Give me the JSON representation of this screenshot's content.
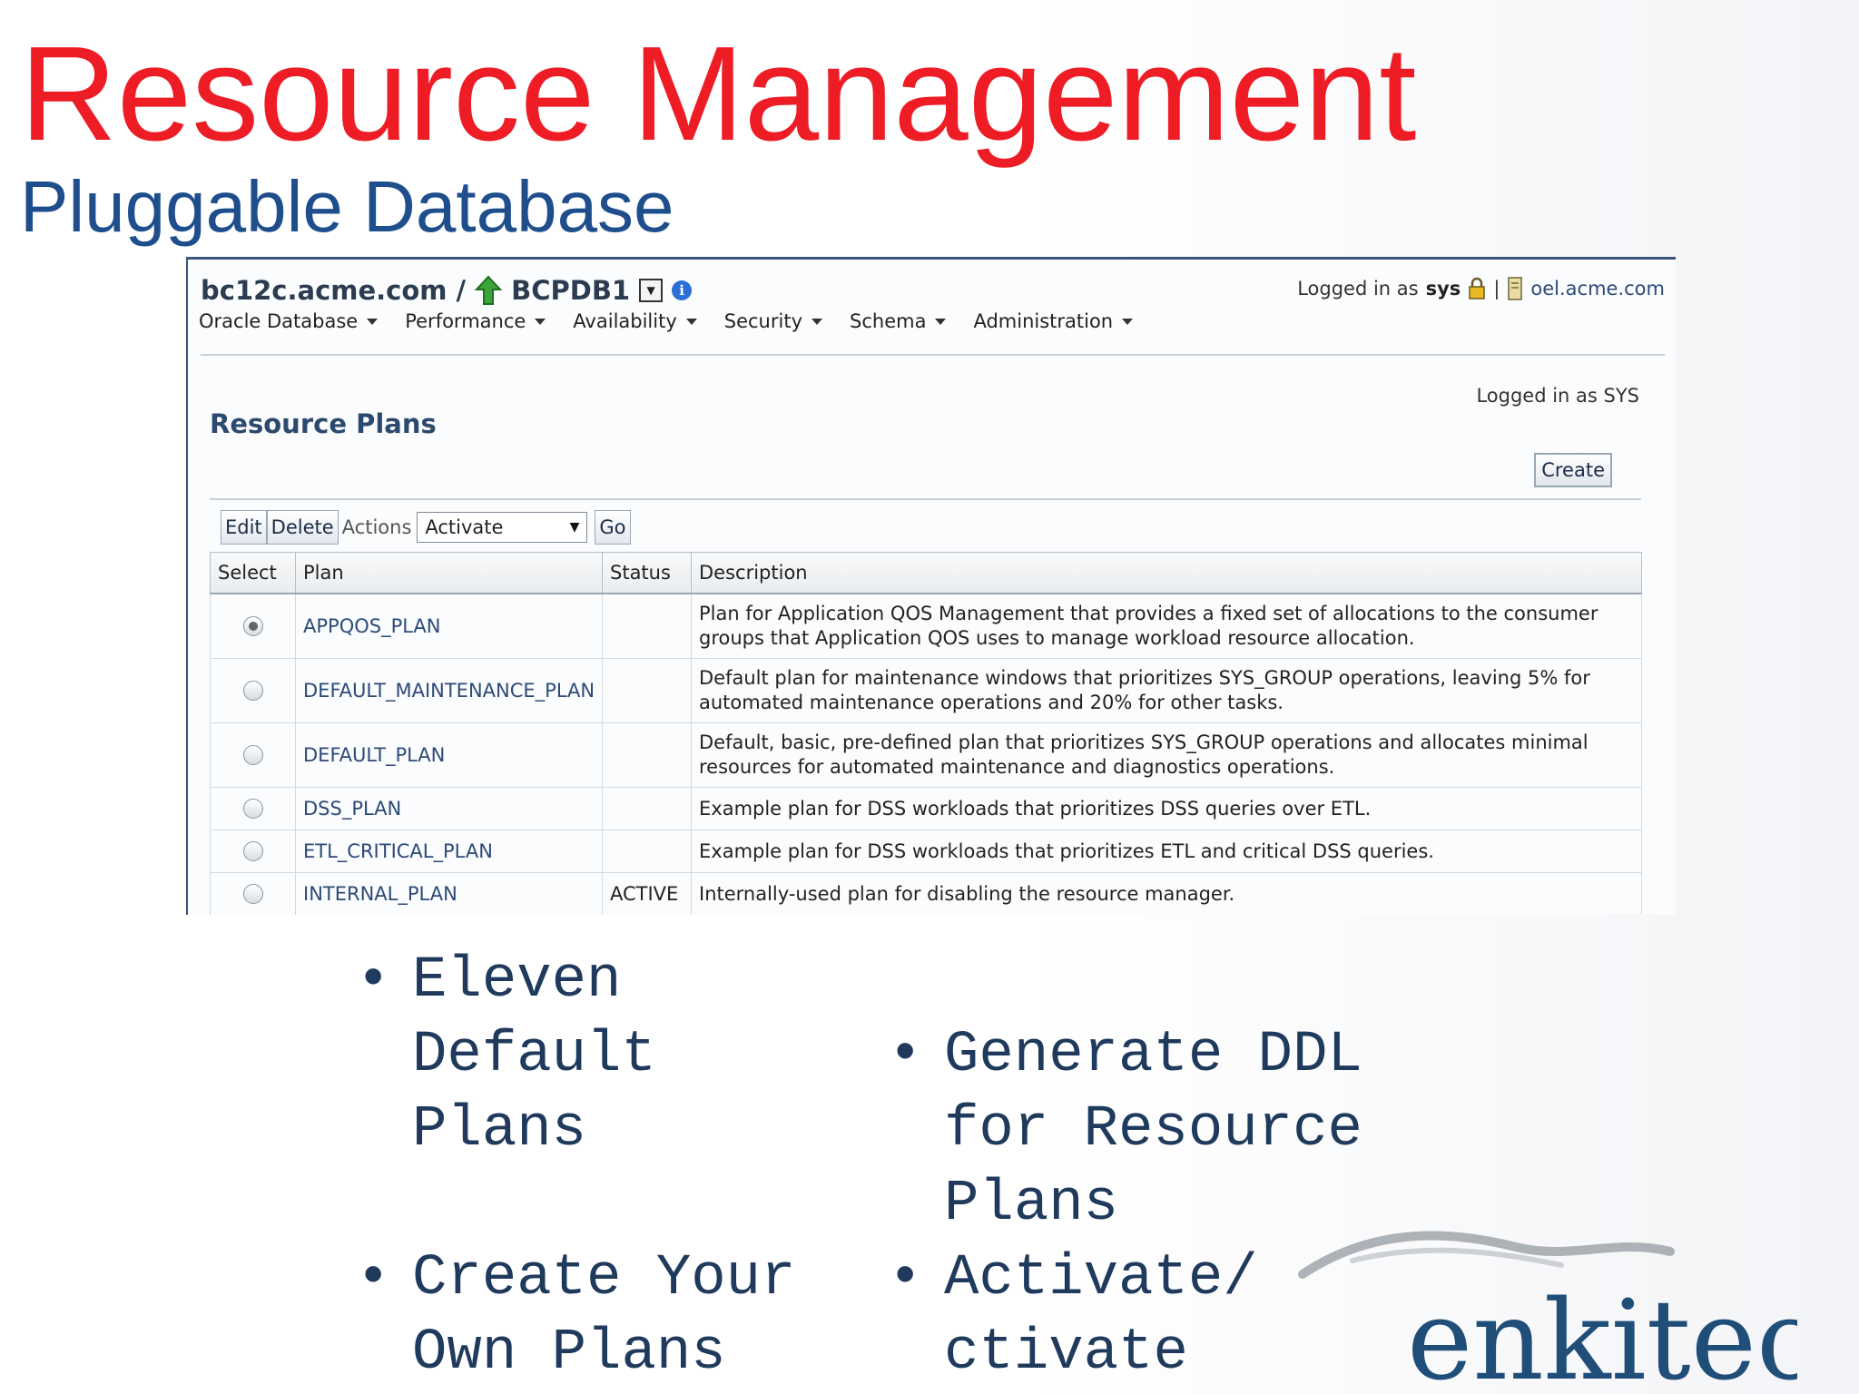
{
  "slide": {
    "title": "Resource Management",
    "subtitle": "Pluggable Database"
  },
  "em": {
    "breadcrumb": {
      "host": "bc12c.acme.com",
      "separator": "/",
      "database": "BCPDB1"
    },
    "login": {
      "prefix": "Logged in as",
      "user": "sys",
      "divider": "|",
      "host": "oel.acme.com"
    },
    "nav": [
      "Oracle Database",
      "Performance",
      "Availability",
      "Security",
      "Schema",
      "Administration"
    ],
    "logged_in_as": "Logged in as SYS",
    "section_title": "Resource Plans",
    "create_label": "Create",
    "toolbar": {
      "edit": "Edit",
      "delete": "Delete",
      "actions_label": "Actions",
      "action_selected": "Activate",
      "go": "Go"
    },
    "table": {
      "headers": [
        "Select",
        "Plan",
        "Status",
        "Description"
      ],
      "rows": [
        {
          "selected": true,
          "plan": "APPQOS_PLAN",
          "status": "",
          "description": "Plan for Application QOS Management that provides a fixed set of allocations to the consumer groups that Application QOS uses to manage workload resource allocation."
        },
        {
          "selected": false,
          "plan": "DEFAULT_MAINTENANCE_PLAN",
          "status": "",
          "description": "Default plan for maintenance windows that prioritizes SYS_GROUP operations, leaving 5% for automated maintenance operations and 20% for other tasks."
        },
        {
          "selected": false,
          "plan": "DEFAULT_PLAN",
          "status": "",
          "description": "Default, basic, pre-defined plan that prioritizes SYS_GROUP operations and allocates minimal resources for automated maintenance and diagnostics operations."
        },
        {
          "selected": false,
          "plan": "DSS_PLAN",
          "status": "",
          "description": "Example plan for DSS workloads that prioritizes DSS queries over ETL."
        },
        {
          "selected": false,
          "plan": "ETL_CRITICAL_PLAN",
          "status": "",
          "description": "Example plan for DSS workloads that prioritizes ETL and critical DSS queries."
        },
        {
          "selected": false,
          "plan": "INTERNAL_PLAN",
          "status": "ACTIVE",
          "description": "Internally-used plan for disabling the resource manager."
        }
      ]
    }
  },
  "bullets": {
    "marker": "•",
    "items": [
      "Eleven\nDefault\nPlans",
      "Generate DDL\nfor Resource\nPlans",
      "Create Your\nOwn Plans",
      "Activate/\nctivate"
    ]
  },
  "logo": {
    "text": "enkitec"
  },
  "colors": {
    "title": "#ee1c25",
    "subtitle": "#1f4e8c",
    "link": "#2c4a78",
    "bullet_text": "#1f3a5c",
    "logo": "#1f4e79"
  }
}
